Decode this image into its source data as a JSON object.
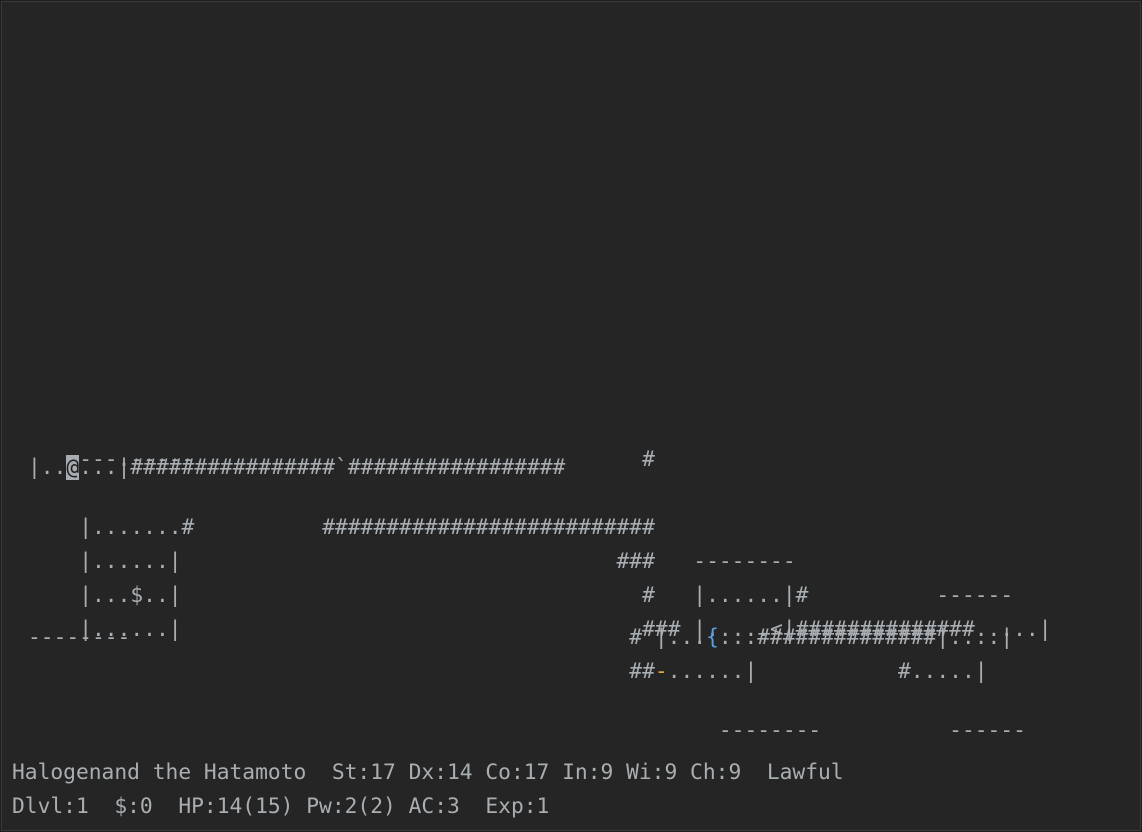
{
  "map": {
    "rows": [
      [
        "---.-----                                   #"
      ],
      [
        "|..",
        "@",
        "...|################`#################"
      ],
      [
        "|.......#          ##########################"
      ],
      [
        "|......|                                  ###   --------"
      ],
      [
        "|...$..|                                    #   |......|#          ------"
      ],
      [
        "|......|                                    ### |.....<|##############.....|"
      ],
      [
        "--------                                       # |...",
        "{",
        "...##############|....|"
      ],
      [
        "                                               ##",
        "-",
        "......|           #.....|"
      ],
      [
        "                                                  --------          ------"
      ]
    ],
    "legend_glyphs": {
      "hero": "@",
      "fountain": "{",
      "open_door": "-",
      "gold": "$",
      "upstairs": "<",
      "boulder": "`"
    }
  },
  "status": {
    "line1": "Halogenand the Hatamoto  St:17 Dx:14 Co:17 In:9 Wi:9 Ch:9  Lawful",
    "line2": "Dlvl:1  $:0  HP:14(15) Pw:2(2) AC:3  Exp:1"
  },
  "colors": {
    "background": "#252525",
    "text": "#a8aeb2",
    "hero_highlight": "#a6acb0",
    "fountain": "#5aa0e8",
    "open_door": "#e3a83a"
  }
}
